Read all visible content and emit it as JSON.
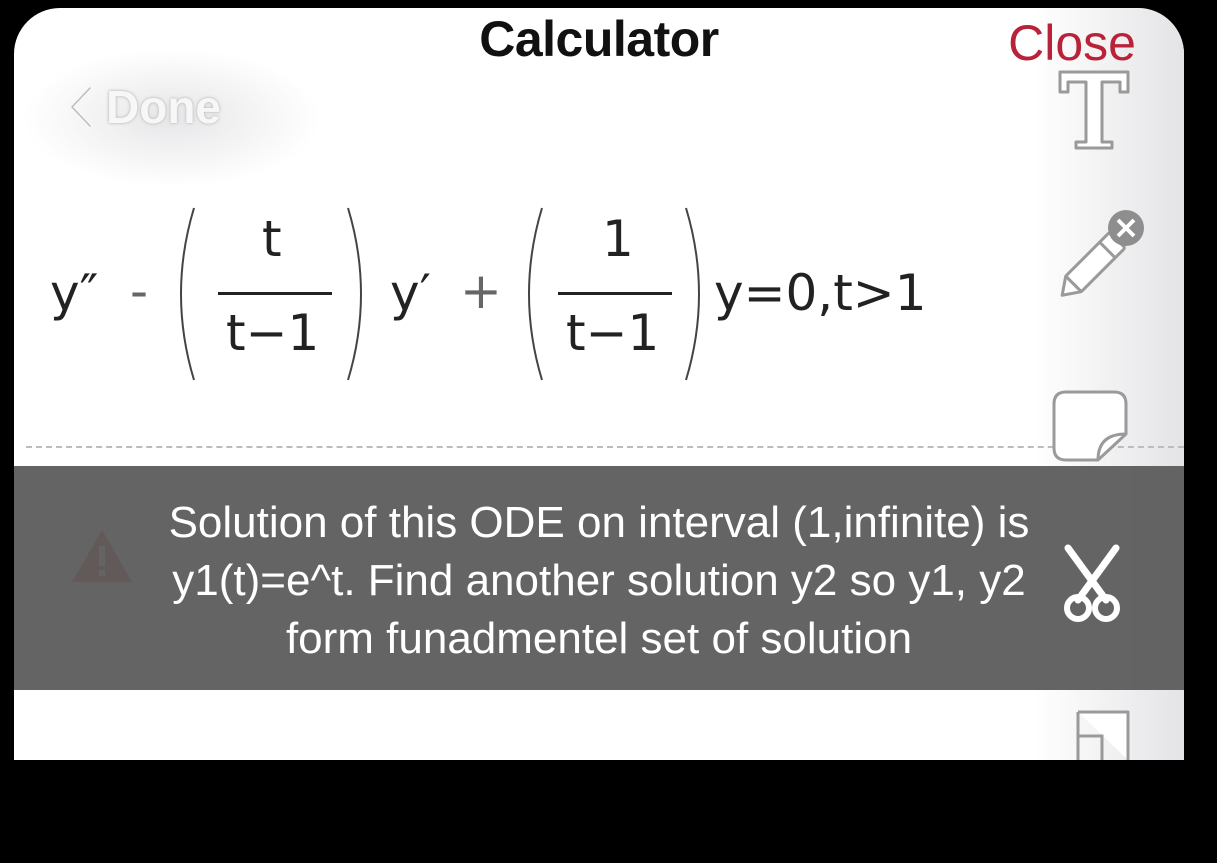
{
  "header": {
    "title": "Calculator",
    "close_label": "Close",
    "back_label": "Done"
  },
  "equation": {
    "y_double_prime": "y″",
    "minus": "-",
    "frac1_num": "t",
    "frac1_den": "t−1",
    "y_prime": "y′",
    "plus": "+",
    "frac2_num": "1",
    "frac2_den": "t−1",
    "rhs": "y=0,t>1"
  },
  "question": {
    "line1": "Solution of this ODE on interval (1,infinite) is",
    "line2": "y1(t)=e^t. Find another solution y2 so y1, y2",
    "line3": "form funadmentel set of solution"
  },
  "toolbar": {
    "icons": [
      "text-icon",
      "pencil-icon",
      "sticker-icon",
      "scissors-icon",
      "note-icon"
    ]
  },
  "colors": {
    "accent": "#b8233a",
    "banner": "#5c5c5c",
    "warning": "#c0392b"
  }
}
